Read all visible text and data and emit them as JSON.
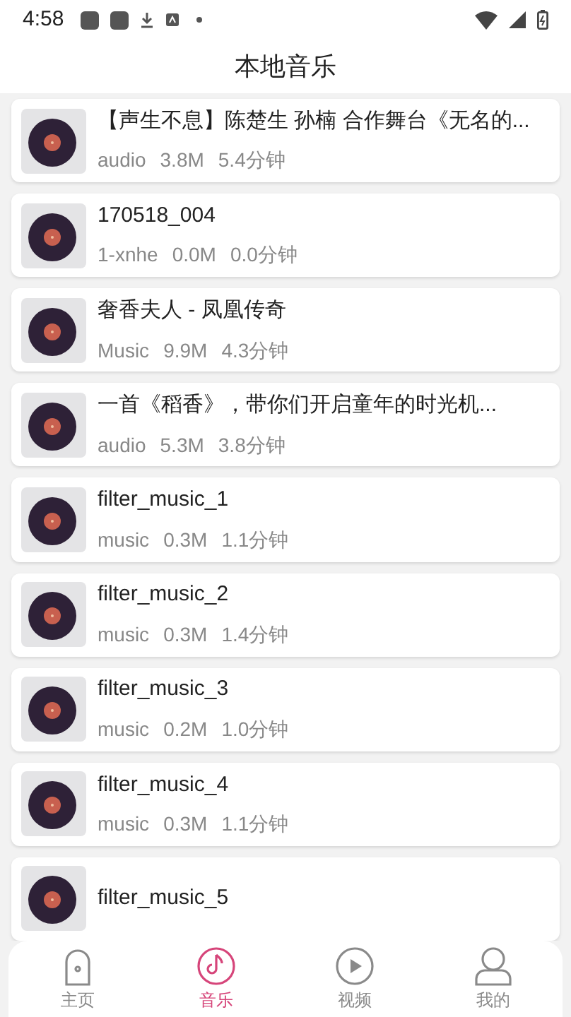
{
  "status_bar": {
    "time": "4:58"
  },
  "title": "本地音乐",
  "songs": [
    {
      "title": "【声生不息】陈楚生 孙楠 合作舞台《无名的...",
      "source": "audio",
      "size": "3.8M",
      "duration": "5.4分钟"
    },
    {
      "title": "170518_004",
      "source": "1-xnhe",
      "size": "0.0M",
      "duration": "0.0分钟"
    },
    {
      "title": "奢香夫人 - 凤凰传奇",
      "source": "Music",
      "size": "9.9M",
      "duration": "4.3分钟"
    },
    {
      "title": "一首《稻香》，带你们开启童年的时光机...",
      "source": "audio",
      "size": "5.3M",
      "duration": "3.8分钟"
    },
    {
      "title": "filter_music_1",
      "source": "music",
      "size": "0.3M",
      "duration": "1.1分钟"
    },
    {
      "title": "filter_music_2",
      "source": "music",
      "size": "0.3M",
      "duration": "1.4分钟"
    },
    {
      "title": "filter_music_3",
      "source": "music",
      "size": "0.2M",
      "duration": "1.0分钟"
    },
    {
      "title": "filter_music_4",
      "source": "music",
      "size": "0.3M",
      "duration": "1.1分钟"
    },
    {
      "title": "filter_music_5"
    }
  ],
  "nav": [
    {
      "label": "主页",
      "kind": "home",
      "selected": false
    },
    {
      "label": "音乐",
      "kind": "music",
      "selected": true
    },
    {
      "label": "视频",
      "kind": "video",
      "selected": false
    },
    {
      "label": "我的",
      "kind": "profile",
      "selected": false
    }
  ]
}
